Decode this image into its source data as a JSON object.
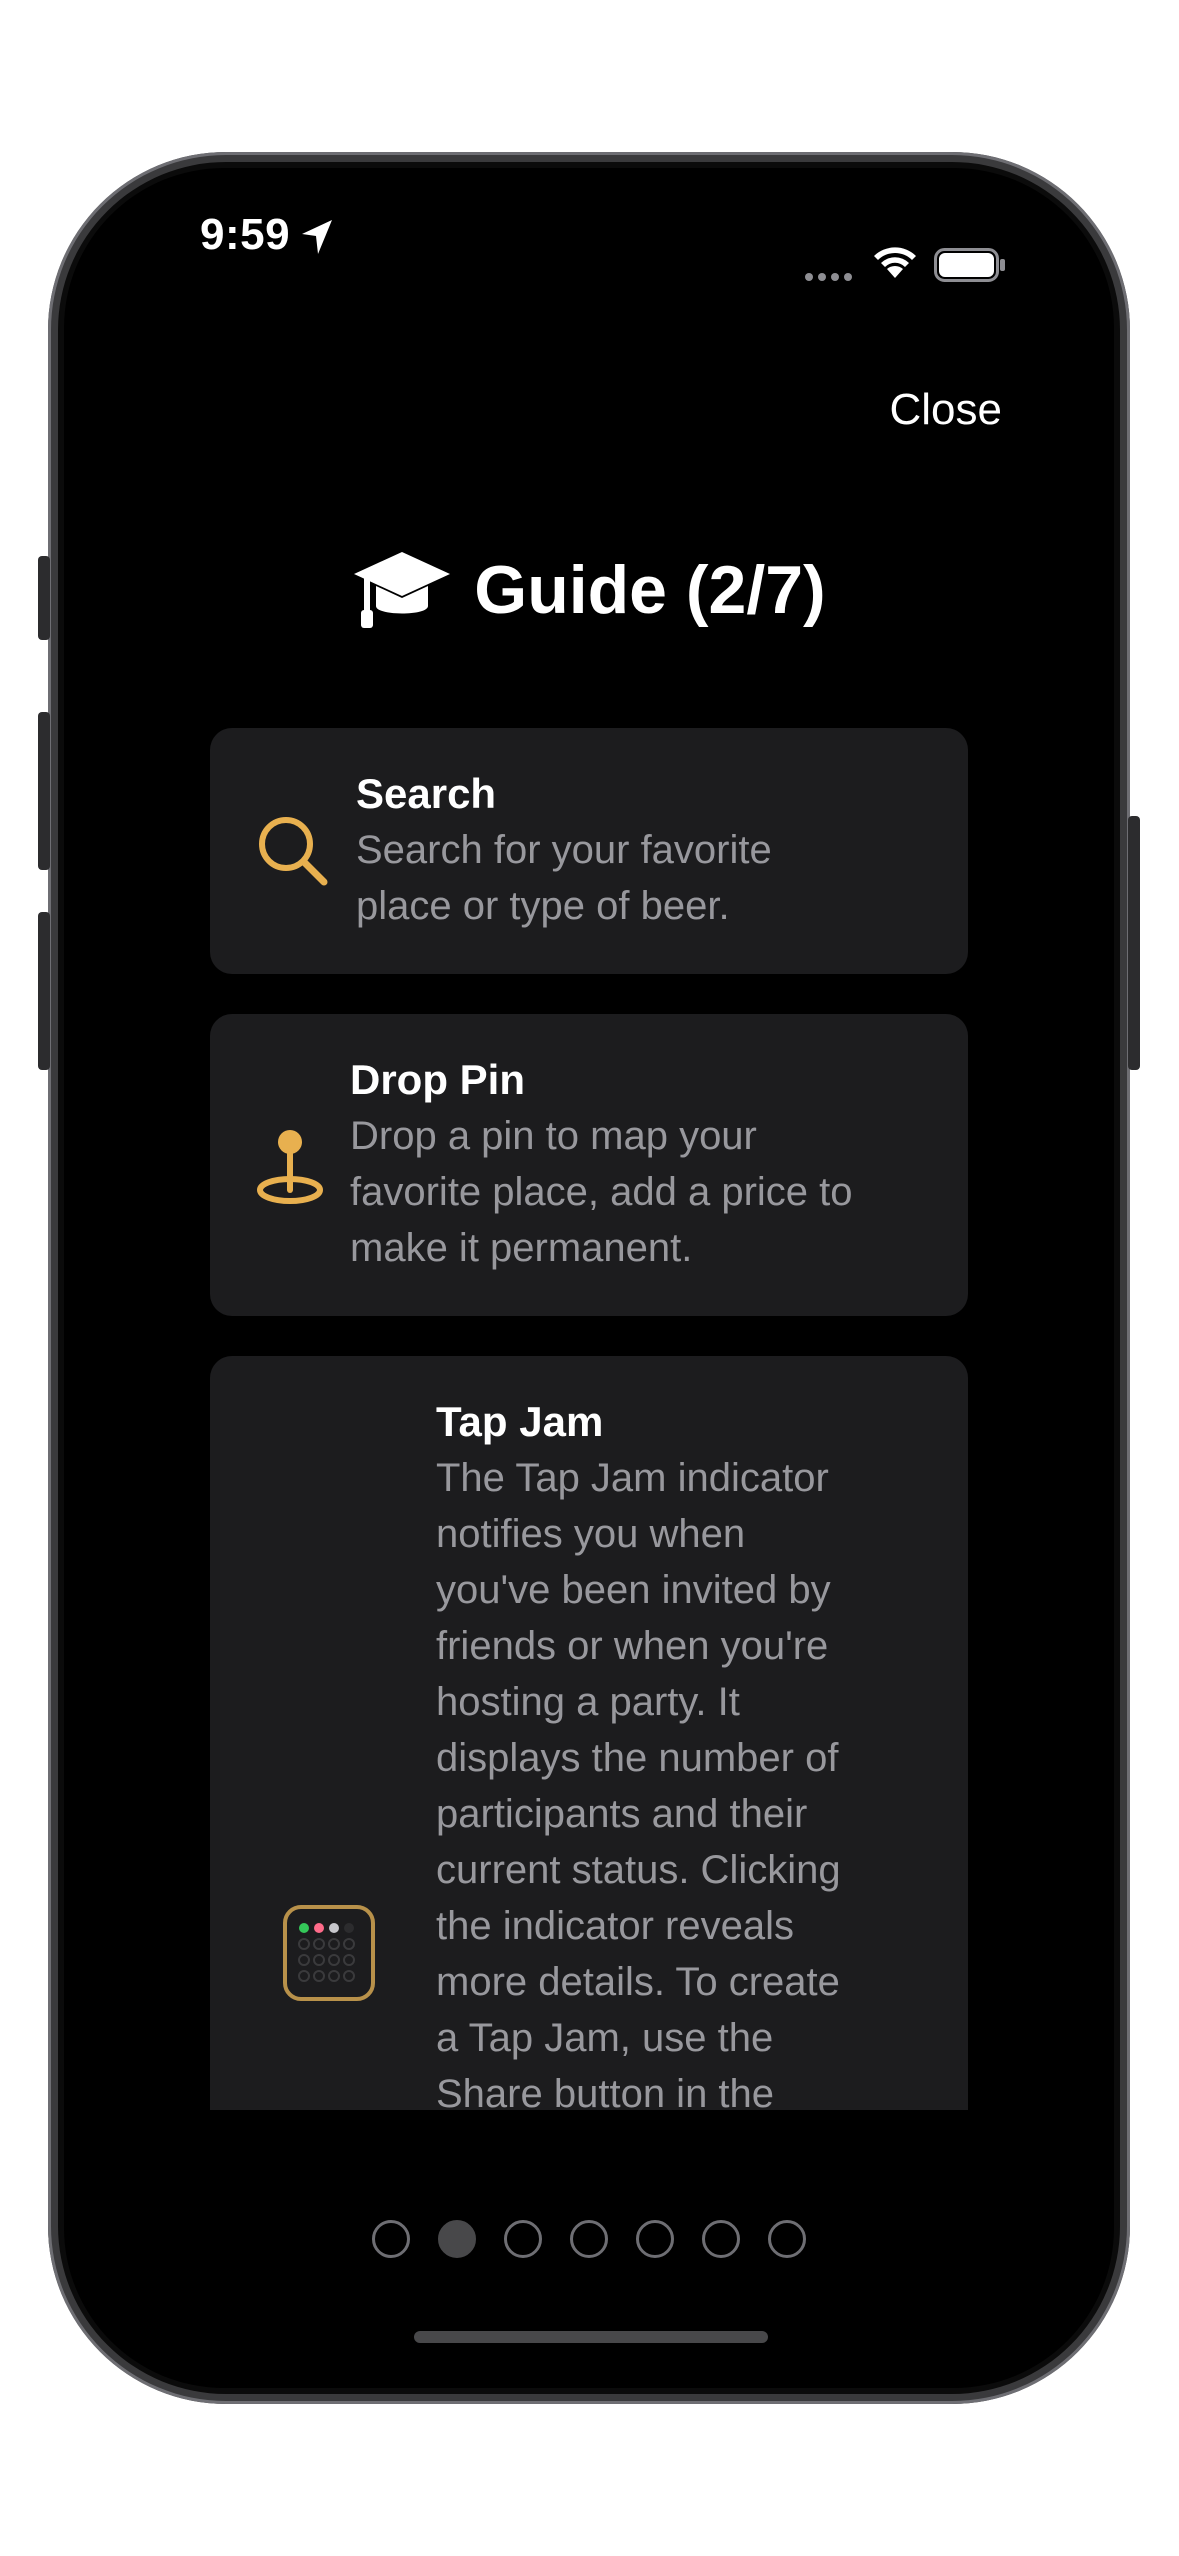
{
  "status_bar": {
    "time": "9:59"
  },
  "header": {
    "close_label": "Close",
    "title": "Guide (2/7)",
    "title_icon": "graduation-cap-icon"
  },
  "cards": [
    {
      "icon": "magnifying-glass-icon",
      "title": "Search",
      "body": "Search for your favorite\nplace or type of beer."
    },
    {
      "icon": "map-pin-icon",
      "title": "Drop Pin",
      "body": "Drop a pin to map your\nfavorite place, add a price to\nmake it permanent."
    },
    {
      "icon": "tap-jam-indicator-icon",
      "title": "Tap Jam",
      "body": "The Tap Jam indicator\nnotifies you when\nyou've been invited by\nfriends or when you're\nhosting a party. It\ndisplays the number of\nparticipants and their\ncurrent status. Clicking\nthe indicator reveals\nmore details. To create\na Tap Jam, use the\nShare button in the\nPreview Screen or Tap"
    }
  ],
  "pager": {
    "total": 7,
    "current": 2
  },
  "colors": {
    "accent": "#E8B04F",
    "card_bg": "#1C1C1E",
    "secondary_text": "#98989D",
    "background": "#000000"
  }
}
